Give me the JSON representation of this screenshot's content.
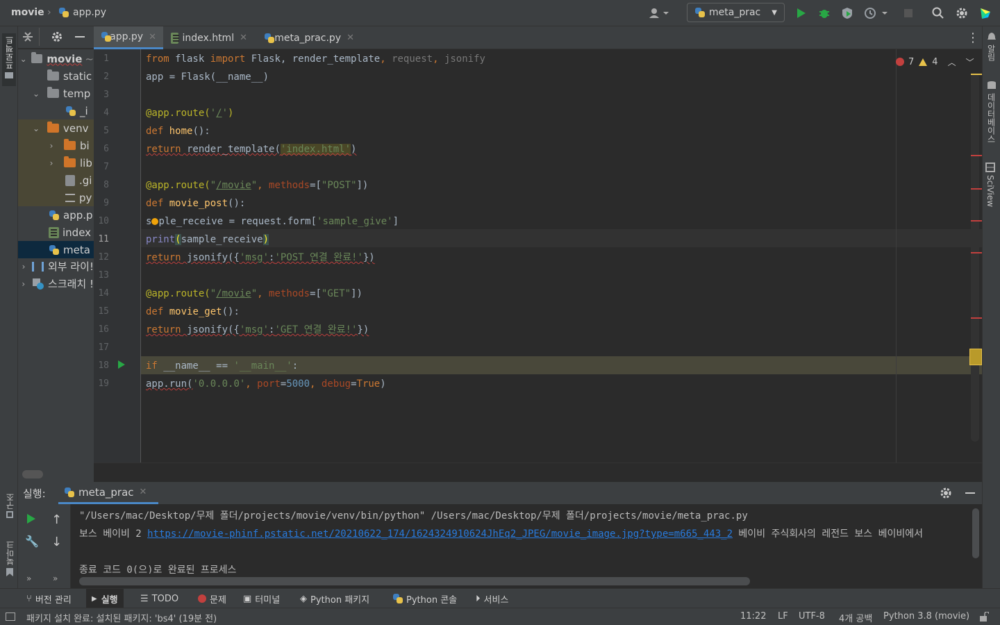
{
  "titlebar": {
    "project_name": "movie",
    "current_file": "app.py",
    "run_config": "meta_prac"
  },
  "colors": {
    "accent": "#4a88c7",
    "run_green": "#28a745",
    "error_red": "#c2403e",
    "warning_yellow": "#e8c24a"
  },
  "left_stripe": {
    "project_label": "프로젝트",
    "structure_label": "구조",
    "bookmarks_label": "북마크"
  },
  "right_stripe": {
    "notifications_label": "알림",
    "database_label": "데이터베이스",
    "sciview_label": "SciView"
  },
  "project_tree": [
    {
      "label": "movie",
      "suffix": "~",
      "type": "folder"
    },
    {
      "label": "static",
      "type": "folder"
    },
    {
      "label": "temp",
      "type": "folder"
    },
    {
      "label": "_i",
      "type": "pyfile"
    },
    {
      "label": "venv",
      "type": "folder-orange"
    },
    {
      "label": "bi",
      "type": "folder-orange"
    },
    {
      "label": "lib",
      "type": "folder-orange"
    },
    {
      "label": ".gi",
      "type": "file"
    },
    {
      "label": "py",
      "type": "file"
    },
    {
      "label": "app.p",
      "type": "pyfile"
    },
    {
      "label": "index",
      "type": "htmlfile"
    },
    {
      "label": "meta",
      "type": "pyfile"
    },
    {
      "label": "외부 라이!",
      "type": "library"
    },
    {
      "label": "스크래치 !",
      "type": "scratch"
    }
  ],
  "tabs": [
    {
      "label": "app.py",
      "active": true
    },
    {
      "label": "index.html",
      "active": false
    },
    {
      "label": "meta_prac.py",
      "active": false
    }
  ],
  "inspections": {
    "errors": "7",
    "warnings": "4"
  },
  "current_line": "11",
  "code_lines": [
    "1",
    "2",
    "3",
    "4",
    "5",
    "6",
    "7",
    "8",
    "9",
    "10",
    "11",
    "12",
    "13",
    "14",
    "15",
    "16",
    "17",
    "18",
    "19"
  ],
  "run_panel": {
    "title": "실행:",
    "tab": "meta_prac",
    "command": "\"/Users/mac/Desktop/무제 폴더/projects/movie/venv/bin/python\" /Users/mac/Desktop/무제 폴더/projects/movie/meta_prac.py",
    "output_prefix": "보스 베이비 2 ",
    "output_link": "https://movie-phinf.pstatic.net/20210622_174/1624324910624JhEq2_JPEG/movie_image.jpg?type=m665_443_2",
    "output_suffix": " 베이비 주식회사의 레전드 보스 베이비에서",
    "exit_message": "종료 코드 0(으)로 완료된 프로세스"
  },
  "bottom_tabs": [
    "버전 관리",
    "실행",
    "TODO",
    "문제",
    "터미널",
    "Python 패키지",
    "Python 콘솔",
    "서비스"
  ],
  "status": {
    "message": "패키지 설치 완료: 설치된 패키지: 'bs4' (19분 전)",
    "position": "11:22",
    "line_sep": "LF",
    "encoding": "UTF-8",
    "indent": "4개 공백",
    "interpreter": "Python 3.8 (movie)"
  }
}
